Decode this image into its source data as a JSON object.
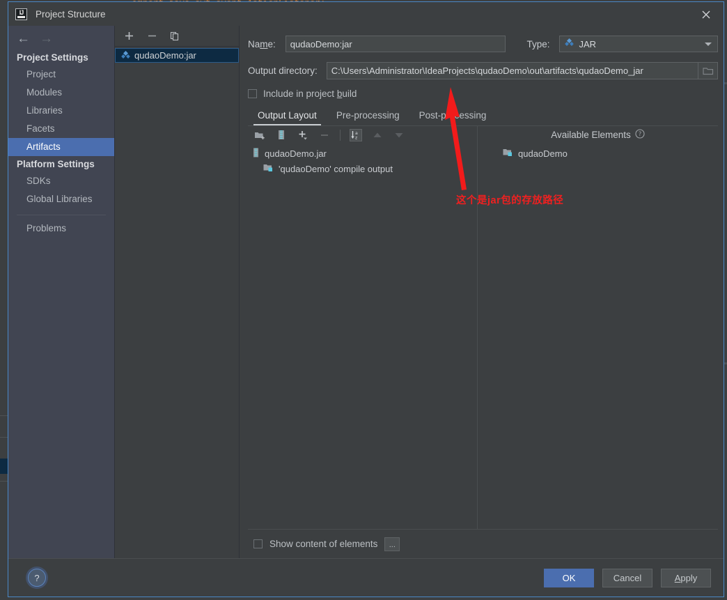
{
  "ide_background": {
    "code_line": "import java.awt.event.ActionListener;"
  },
  "dialog": {
    "title": "Project Structure",
    "logo_icon": "intellij-idea-logo-icon",
    "close_icon": "close-icon",
    "nav": {
      "back_icon": "arrow-left-icon",
      "forward_icon": "arrow-right-icon"
    }
  },
  "sidebar": {
    "groups": [
      {
        "label": "Project Settings",
        "items": [
          {
            "label": "Project",
            "selected": false
          },
          {
            "label": "Modules",
            "selected": false
          },
          {
            "label": "Libraries",
            "selected": false
          },
          {
            "label": "Facets",
            "selected": false
          },
          {
            "label": "Artifacts",
            "selected": true
          }
        ]
      },
      {
        "label": "Platform Settings",
        "items": [
          {
            "label": "SDKs",
            "selected": false
          },
          {
            "label": "Global Libraries",
            "selected": false
          }
        ]
      }
    ],
    "problems_label": "Problems"
  },
  "artifact_panel": {
    "toolbar": [
      {
        "name": "add-artifact-button",
        "icon": "plus-icon"
      },
      {
        "name": "remove-artifact-button",
        "icon": "minus-icon"
      },
      {
        "name": "copy-artifact-button",
        "icon": "copy-icon"
      }
    ],
    "items": [
      {
        "label": "qudaoDemo:jar",
        "icon": "artifact-diamond-icon",
        "selected": true
      }
    ]
  },
  "form": {
    "name_label": "Name:",
    "name_label_mnemonic": "m",
    "name_value": "qudaoDemo:jar",
    "type_label": "Type:",
    "type_value": "JAR",
    "type_icon": "artifact-diamond-icon",
    "output_dir_label": "Output directory:",
    "output_dir_value": "C:\\Users\\Administrator\\IdeaProjects\\qudaoDemo\\out\\artifacts\\qudaoDemo_jar",
    "browse_icon": "folder-open-icon",
    "include_checkbox_label": "Include in project build",
    "include_checkbox_checked": false
  },
  "tabs": [
    {
      "label": "Output Layout",
      "active": true
    },
    {
      "label": "Pre-processing",
      "active": false
    },
    {
      "label": "Post-processing",
      "active": false
    }
  ],
  "layout_toolbar": [
    {
      "name": "add-directory-button",
      "icon": "folder-add-icon"
    },
    {
      "name": "add-archive-button",
      "icon": "archive-icon"
    },
    {
      "name": "add-element-button",
      "icon": "plus-dropdown-icon"
    },
    {
      "name": "remove-element-button",
      "icon": "minus-icon"
    },
    {
      "name": "sort-elements-button",
      "icon": "sort-alpha-icon"
    },
    {
      "name": "move-up-button",
      "icon": "arrow-up-icon"
    },
    {
      "name": "move-down-button",
      "icon": "arrow-down-icon"
    }
  ],
  "output_tree": [
    {
      "label": "qudaoDemo.jar",
      "icon": "archive-icon",
      "level": 1
    },
    {
      "label": "'qudaoDemo' compile output",
      "icon": "module-output-icon",
      "level": 2
    }
  ],
  "available_elements": {
    "header": "Available Elements",
    "help_icon": "question-circle-icon",
    "items": [
      {
        "label": "qudaoDemo",
        "icon": "module-output-icon"
      }
    ]
  },
  "content_bottom": {
    "show_content_label": "Show content of elements",
    "show_content_checked": false,
    "dots_button_label": "..."
  },
  "footer": {
    "help_label": "?",
    "ok_label": "OK",
    "cancel_label": "Cancel",
    "apply_label": "Apply"
  },
  "annotation": {
    "text": "这个是jar包的存放路径",
    "color": "#f02020",
    "arrow_icon": "arrow-up-annotation-icon"
  },
  "colors": {
    "panel_bg": "#3c3f41",
    "sidebar_bg": "#414552",
    "selection_blue": "#4b6eaf",
    "list_selection": "#0d2a42",
    "accent_border": "#4a88c7"
  }
}
